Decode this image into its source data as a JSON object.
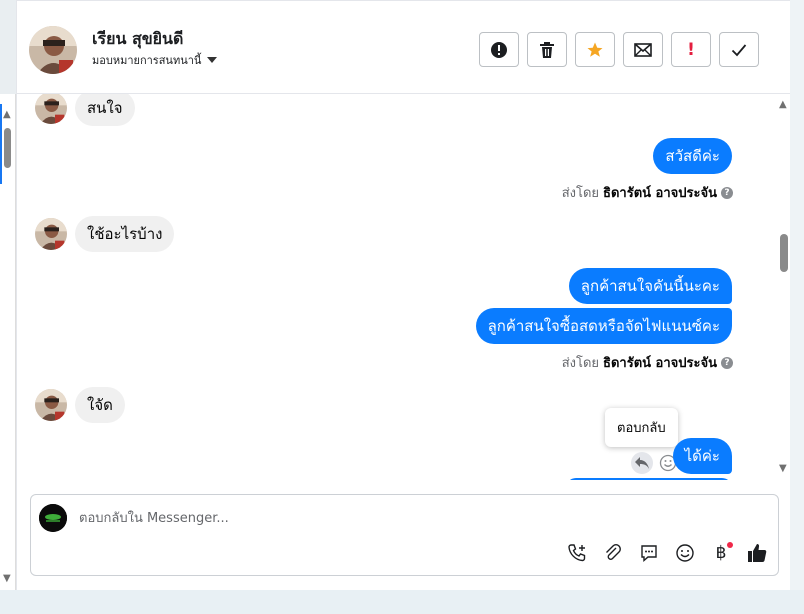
{
  "header": {
    "name": "เรียน สุขยินดี",
    "assign_label": "มอบหมายการสนทนานี้"
  },
  "actions": [
    {
      "icon": "alert-circle-icon",
      "label": ""
    },
    {
      "icon": "trash-icon",
      "label": ""
    },
    {
      "icon": "star-icon",
      "label": ""
    },
    {
      "icon": "mail-icon",
      "label": ""
    },
    {
      "icon": "exclamation-icon",
      "label": "!"
    },
    {
      "icon": "check-icon",
      "label": ""
    }
  ],
  "messages": {
    "in_1": "สนใจ",
    "out_1": "สวัสดีค่ะ",
    "sent_by_prefix_1": "ส่งโดย",
    "sent_by_name_1": "ธิดารัตน์ อาจประจัน",
    "in_2": "ใช้อะไรบ้าง",
    "out_2": "ลูกค้าสนใจคันนี้นะคะ",
    "out_3": "ลูกค้าสนใจซื้อสดหรือจัดไฟแนนซ์คะ",
    "sent_by_prefix_2": "ส่งโดย",
    "sent_by_name_2": "ธิดารัตน์ อาจประจัน",
    "in_3": "ใจัด",
    "out_4": "ได้ค่ะ"
  },
  "tooltip": "ตอบกลับ",
  "composer": {
    "placeholder": "ตอบกลับใน Messenger..."
  },
  "tools": [
    "phone-plus-icon",
    "paperclip-icon",
    "chat-bubble-icon",
    "emoji-icon",
    "baht-icon",
    "thumbs-up-icon"
  ],
  "colors": {
    "outgoing_bubble": "#0a7cff",
    "incoming_bubble": "#f0f0f0",
    "star": "#f5a623",
    "exclamation": "#e41e3f"
  }
}
